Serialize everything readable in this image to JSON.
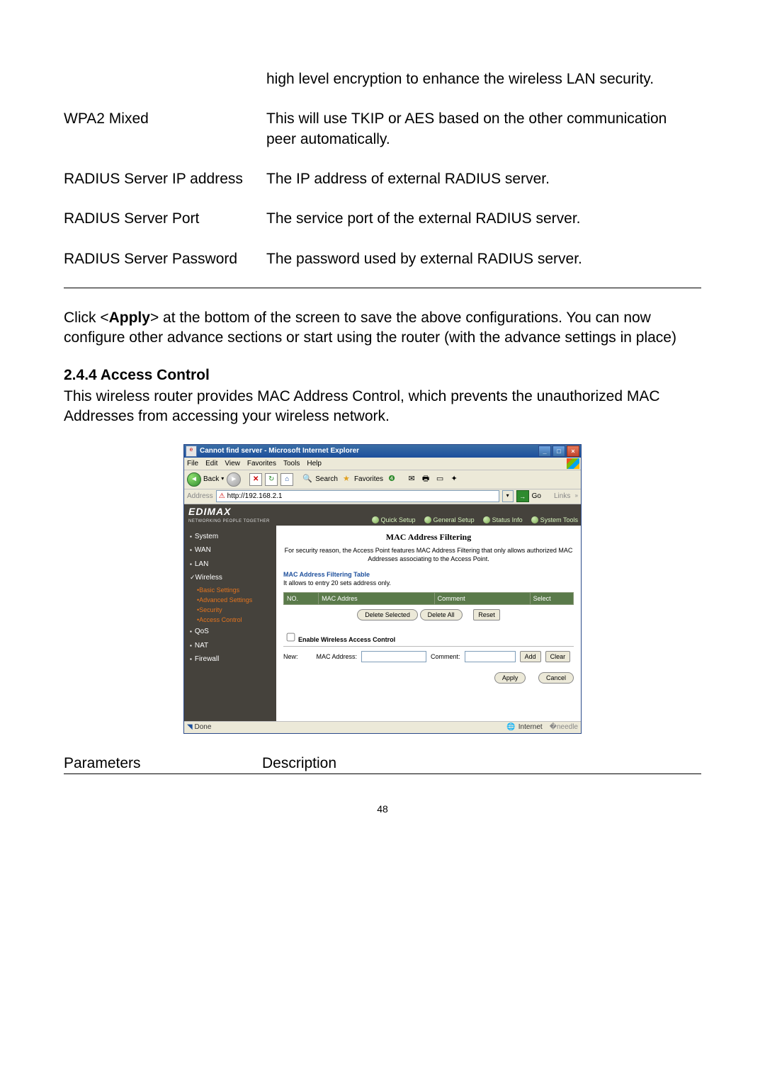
{
  "params_top": [
    {
      "name": "",
      "desc": "high level encryption to enhance the wireless LAN security."
    },
    {
      "name": "WPA2 Mixed",
      "desc": "This will use TKIP or AES based on the other communication peer automatically."
    },
    {
      "name": "RADIUS Server IP address",
      "desc": "The IP address of external RADIUS server."
    },
    {
      "name": "RADIUS Server Port",
      "desc": "The service port of the external RADIUS server."
    },
    {
      "name": "RADIUS Server Password",
      "desc": "The password used by external RADIUS server."
    }
  ],
  "body1_pre": "Click <",
  "body1_bold": "Apply",
  "body1_post": "> at the bottom of the screen to save the above configurations. You can now configure other advance sections or start using the router (with the advance settings in place)",
  "section_head": "2.4.4 Access Control",
  "section_body": "This wireless router provides MAC Address Control, which prevents the unauthorized MAC Addresses from accessing your wireless network.",
  "ie": {
    "title": "Cannot find server - Microsoft Internet Explorer",
    "menus": [
      "File",
      "Edit",
      "View",
      "Favorites",
      "Tools",
      "Help"
    ],
    "back": "Back",
    "search": "Search",
    "favorites": "Favorites",
    "addr_label": "Address",
    "url": "http://192.168.2.1",
    "go": "Go",
    "links": "Links",
    "brand": "EDIMAX",
    "brand_sub": "NETWORKING PEOPLE TOGETHER",
    "topnav": [
      "Quick Setup",
      "General Setup",
      "Status Info",
      "System Tools"
    ],
    "sidebar": {
      "system": "System",
      "wan": "WAN",
      "lan": "LAN",
      "wireless": "Wireless",
      "subs": [
        "Basic Settings",
        "Advanced Settings",
        "Security",
        "Access Control"
      ],
      "qos": "QoS",
      "nat": "NAT",
      "firewall": "Firewall"
    },
    "page": {
      "title": "MAC Address Filtering",
      "desc": "For security reason, the Access Point features MAC Address Filtering that only allows authorized MAC Addresses associating to the Access Point.",
      "table_head": "MAC Address Filtering Table",
      "table_sub": "It allows to entry 20 sets address only.",
      "cols": [
        "NO.",
        "MAC Addres",
        "Comment",
        "Select"
      ],
      "btn_delete_sel": "Delete Selected",
      "btn_delete_all": "Delete All",
      "btn_reset": "Reset",
      "enable": "Enable Wireless Access Control",
      "new": "New:",
      "mac": "MAC Address:",
      "comment": "Comment:",
      "add": "Add",
      "clear": "Clear",
      "apply": "Apply",
      "cancel": "Cancel"
    },
    "status_left": "Done",
    "status_right": "Internet"
  },
  "desc_head": {
    "c1": "Parameters",
    "c2": "Description"
  },
  "pagenum": "48"
}
